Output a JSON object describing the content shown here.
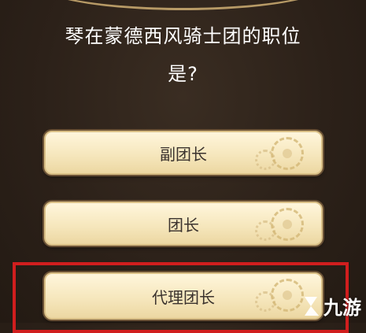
{
  "question": {
    "line1": "琴在蒙德西风骑士团的职位",
    "line2": "是?"
  },
  "options": [
    {
      "label": "副团长",
      "selected": false
    },
    {
      "label": "团长",
      "selected": false
    },
    {
      "label": "代理团长",
      "selected": true
    }
  ],
  "watermark": {
    "icon": "jiuyou-logo-icon",
    "text": "九游"
  },
  "colors": {
    "background": "#2c2119",
    "option_fill": "#f6e7bd",
    "option_text": "#3b332e",
    "highlight": "#d01e1e"
  }
}
